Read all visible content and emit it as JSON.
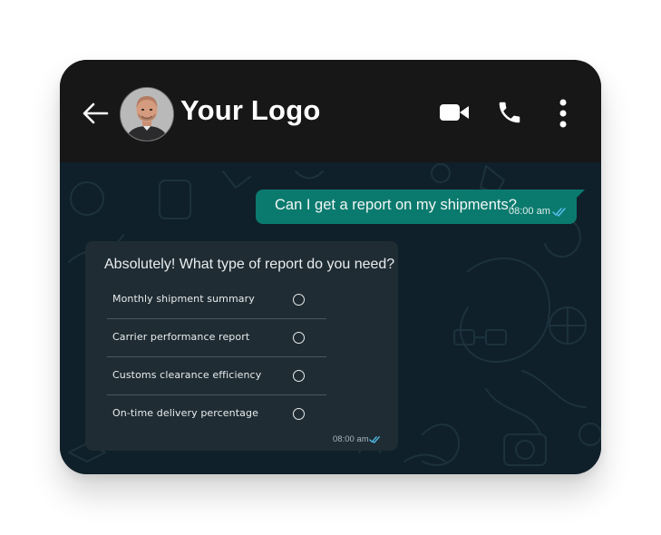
{
  "header": {
    "title": "Your Logo",
    "back_icon": "arrow-left-icon",
    "avatar": "contact-avatar",
    "actions": [
      "video-call-icon",
      "phone-icon",
      "more-vertical-icon"
    ]
  },
  "messages": {
    "outgoing": {
      "text": "Can I get a report on my shipments?",
      "time": "08:00 am",
      "status_icon": "double-check-icon"
    },
    "incoming_poll": {
      "question": "Absolutely! What type of report do you need?",
      "options": [
        {
          "label": "Monthly shipment summary"
        },
        {
          "label": "Carrier performance report"
        },
        {
          "label": "Customs clearance efficiency"
        },
        {
          "label": "On-time delivery percentage"
        }
      ],
      "time": "08:00 am",
      "status_icon": "double-check-icon"
    }
  },
  "colors": {
    "header_bg": "#171717",
    "chat_bg": "#10202a",
    "outgoing_bubble": "#0b7a6e",
    "incoming_bubble": "#1f2c33",
    "read_tick": "#53bdeb"
  }
}
